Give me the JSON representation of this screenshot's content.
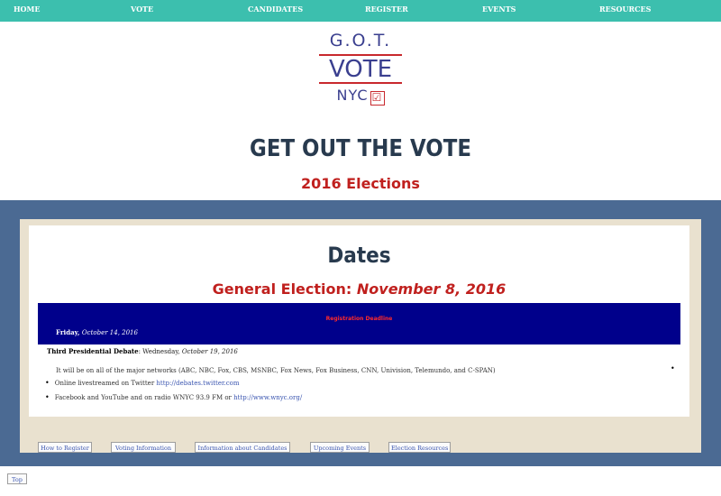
{
  "nav": {
    "items": [
      "HOME",
      "VOTE",
      "CANDIDATES",
      "REGISTER",
      "EVENTS",
      "RESOURCES"
    ]
  },
  "logo": {
    "line1": "G.O.T.",
    "line2": "VOTE",
    "line3": "NYC",
    "check": "☑"
  },
  "header": {
    "title": "GET OUT THE VOTE",
    "subtitle": "2016 Elections"
  },
  "content": {
    "title": "Dates",
    "general_label": "General Election:",
    "general_date": "November 8, 2016",
    "banner_heading": "Registration Deadline",
    "banner_day": "Friday,",
    "banner_date": "October 14, 2016",
    "debate_label": "Third Presidential Debate",
    "debate_day": ": Wednesday,",
    "debate_date": "October 19, 2016",
    "line1": "It will be on all of the major networks (ABC, NBC, Fox, CBS, MSNBC, Fox News, Fox Business, CNN, Univision, Telemundo, and C-SPAN)",
    "bullet2_text": "Online livestreamed on Twitter",
    "bullet2_link": "http://debates.twitter.com",
    "bullet3_text": "Facebook and YouTube and on radio WNYC 93.9 FM or",
    "bullet3_link": "http://www.wnyc.org/"
  },
  "buttons": [
    "How to Register",
    "Voting Information",
    "Information about Candidates",
    "Upcoming Events",
    "Election Resources"
  ],
  "top_button": "Top",
  "colors": {
    "nav_bg": "#3cbfae",
    "frame_blue": "#4b6a93",
    "frame_beige": "#e9e1cf",
    "banner": "#00008b",
    "accent_red": "#c0201e",
    "title_navy": "#283a4e"
  }
}
